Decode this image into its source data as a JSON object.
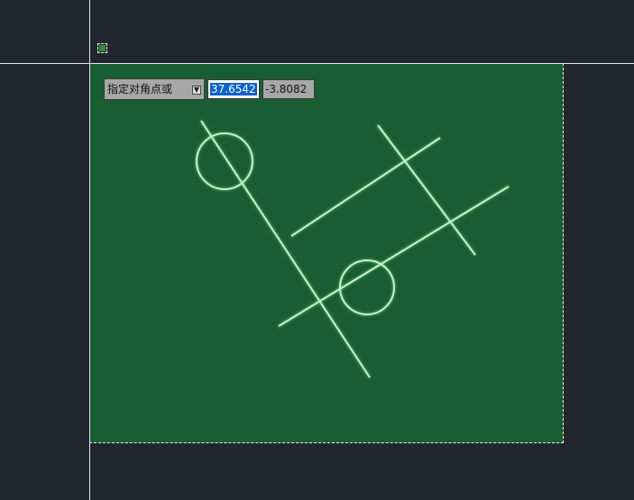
{
  "dynamic_input": {
    "prompt": "指定对角点或",
    "x_value": "37.6542",
    "y_value": "-3.8082"
  },
  "icons": {
    "prompt_menu": "dropdown-arrow-icon",
    "cursor_pickbox": "pickbox-icon"
  },
  "colors": {
    "model_background": "#22262e",
    "selection_fill": "#195e32",
    "geometry_stroke": "#c7f2cd",
    "crosshair": "#e8e8e8",
    "highlight": "#0a62d0"
  }
}
